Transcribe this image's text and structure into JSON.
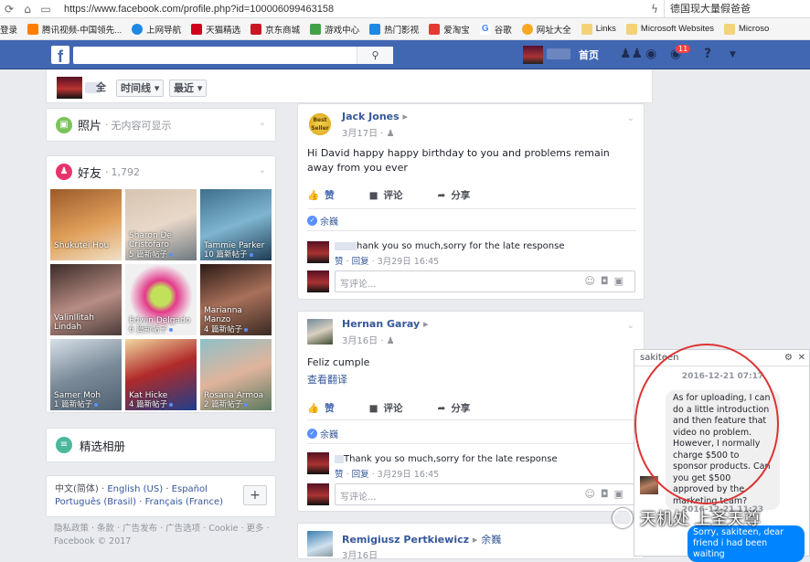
{
  "browser": {
    "url": "https://www.facebook.com/profile.php?id=100006099463158",
    "right_tab": "德国现大量假爸爸",
    "bookmarks": [
      {
        "label": "登录",
        "icon": "none",
        "color": "#f5f5f5"
      },
      {
        "label": "腾讯视频-中国领先...",
        "icon": "tencent-video-icon",
        "color": "#ff7e00"
      },
      {
        "label": "上网导航",
        "icon": "ie-icon",
        "color": "#1e88e5"
      },
      {
        "label": "天猫精选",
        "icon": "tmall-icon",
        "color": "#d0021b"
      },
      {
        "label": "京东商城",
        "icon": "jd-icon",
        "color": "#c91623"
      },
      {
        "label": "游戏中心",
        "icon": "game-icon",
        "color": "#43a047"
      },
      {
        "label": "热门影视",
        "icon": "video-icon",
        "color": "#1e88e5"
      },
      {
        "label": "爱淘宝",
        "icon": "taobao-icon",
        "color": "#e53935"
      },
      {
        "label": "谷歌",
        "icon": "google-icon",
        "color": "#fff"
      },
      {
        "label": "网址大全",
        "icon": "site-directory-icon",
        "color": "#f9a825"
      },
      {
        "label": "Links",
        "icon": "folder-icon",
        "color": "#f3d27a"
      },
      {
        "label": "Microsoft Websites",
        "icon": "folder-icon",
        "color": "#f3d27a"
      },
      {
        "label": "Microso",
        "icon": "folder-icon",
        "color": "#f3d27a"
      }
    ]
  },
  "fb_header": {
    "logo": "f",
    "home": "首页",
    "notification_count": "11",
    "brand_color": "#4267b2"
  },
  "timeline_bar": {
    "tab1": "全",
    "tab2": "时间线",
    "tab3": "最近"
  },
  "photos_card": {
    "title": "照片",
    "subtitle": "无内容可显示"
  },
  "friends_card": {
    "title": "好友",
    "count": "1,792",
    "friends": [
      {
        "name": "Shukutei Hou",
        "posts": ""
      },
      {
        "name": "Sharon De Cristofaro",
        "posts": "5 篇新帖子"
      },
      {
        "name": "Tammie Parker",
        "posts": "10 篇新帖子"
      },
      {
        "name": "Valinllitah Lindah",
        "posts": ""
      },
      {
        "name": "Edwin Delgado",
        "posts": "6 篇新帖子"
      },
      {
        "name": "Marianna Manzo",
        "posts": "4 篇新帖子"
      },
      {
        "name": "Samer Moh",
        "posts": "1 篇新帖子"
      },
      {
        "name": "Kat Hicke",
        "posts": "4 篇新帖子"
      },
      {
        "name": "Rosana Armoa",
        "posts": "2 篇新帖子"
      }
    ]
  },
  "album_card": {
    "title": "精选相册"
  },
  "languages": {
    "current": "中文(简体)",
    "options": [
      "English (US)",
      "Español",
      "Português (Brasil)",
      "Français (France)"
    ],
    "sep": "·"
  },
  "footer": {
    "links": "隐私政策 · 条款 · 广告发布 · 广告选项 · Cookie · 更多 ·",
    "copyright": "Facebook © 2017"
  },
  "posts": [
    {
      "author": "Jack Jones",
      "date": "3月17日",
      "text": "Hi David happy happy birthday to you and problems remain away from you ever",
      "like": "赞",
      "comment": "评论",
      "share": "分享",
      "liker": "余巍",
      "reply_text": "hank you so much,sorry for the late response",
      "reply_meta_like": "赞",
      "reply_meta_reply": "回复",
      "reply_meta_time": "3月29日 16:45",
      "comment_placeholder": "写评论..."
    },
    {
      "author": "Hernan Garay",
      "date": "3月16日",
      "text": "Feliz cumple",
      "translate": "查看翻译",
      "like": "赞",
      "comment": "评论",
      "share": "分享",
      "liker": "余巍",
      "reply_text": "Thank you so much,sorry for the late response",
      "reply_meta_like": "赞",
      "reply_meta_reply": "回复",
      "reply_meta_time": "3月29日 16:45",
      "comment_placeholder": "写评论..."
    },
    {
      "author": "Remigiusz Pertkiewicz",
      "tagged": "余巍",
      "date": "3月16日"
    }
  ],
  "chat": {
    "name": "sakiteen",
    "timestamp1": "2016-12-21 07:17",
    "message_in": "As for uploading, I can do a little introduction and then feature that video no problem. However, I normally charge $500 to sponsor products. Can you get $500 approved by the marketing team?",
    "timestamp2": "2016-12-21 11:23",
    "message_out": "Sorry, sakiteen, dear friend i had been waiting"
  },
  "watermark": "天机处 上圣天尊"
}
